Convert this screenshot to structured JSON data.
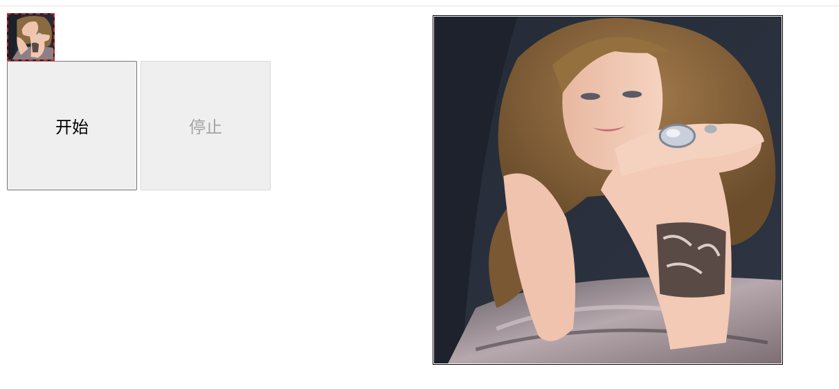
{
  "buttons": {
    "start_label": "开始",
    "stop_label": "停止",
    "stop_disabled": true
  },
  "thumbnail": {
    "border_color": "#d42020",
    "selected": true
  },
  "colors": {
    "button_bg": "#efefef",
    "disabled_text": "#a3a3a3",
    "photo_background": "#232a35"
  }
}
